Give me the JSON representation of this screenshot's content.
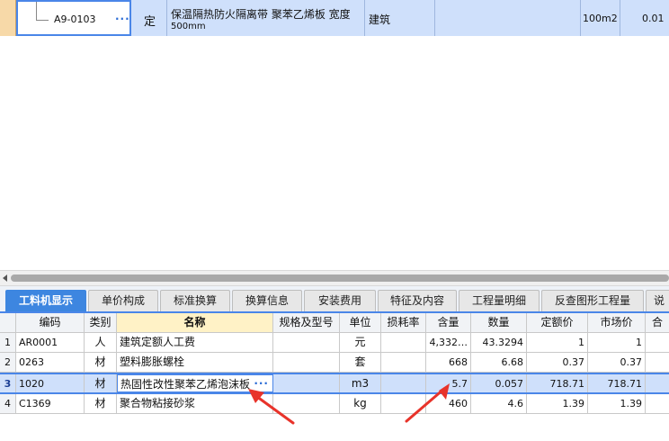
{
  "quota_row": {
    "code": "A9-0103",
    "type": "定",
    "name_line1": "保温隔热防火隔离带 聚苯乙烯板 宽度",
    "name_line2": "500mm",
    "profession": "建筑",
    "unit": "100m2",
    "quantity": "0.01"
  },
  "ellipsis": "···",
  "tabs": [
    {
      "label": "工料机显示",
      "active": true
    },
    {
      "label": "单价构成"
    },
    {
      "label": "标准换算"
    },
    {
      "label": "换算信息"
    },
    {
      "label": "安装费用"
    },
    {
      "label": "特征及内容"
    },
    {
      "label": "工程量明细"
    },
    {
      "label": "反查图形工程量"
    },
    {
      "label": "说"
    }
  ],
  "grid": {
    "headers": [
      "编码",
      "类别",
      "名称",
      "规格及型号",
      "单位",
      "损耗率",
      "含量",
      "数量",
      "定额价",
      "市场价",
      "合"
    ],
    "rows": [
      {
        "num": "1",
        "code": "AR0001",
        "type": "人",
        "name": "建筑定额人工费",
        "spec": "",
        "unit": "元",
        "loss": "",
        "content": "4,332…",
        "qty": "43.3294",
        "quota_price": "1",
        "market_price": "1"
      },
      {
        "num": "2",
        "code": "0263",
        "type": "材",
        "name": "塑料膨胀螺栓",
        "spec": "",
        "unit": "套",
        "loss": "",
        "content": "668",
        "qty": "6.68",
        "quota_price": "0.37",
        "market_price": "0.37"
      },
      {
        "num": "3",
        "code": "1020",
        "type": "材",
        "name": "热固性改性聚苯乙烯泡沫板",
        "spec": "",
        "unit": "m3",
        "loss": "",
        "content": "5.7",
        "qty": "0.057",
        "quota_price": "718.71",
        "market_price": "718.71"
      },
      {
        "num": "4",
        "code": "C1369",
        "type": "材",
        "name": "聚合物粘接砂浆",
        "spec": "",
        "unit": "kg",
        "loss": "",
        "content": "460",
        "qty": "4.6",
        "quota_price": "1.39",
        "market_price": "1.39"
      }
    ]
  },
  "colors": {
    "accent": "#4a86e8",
    "selection": "#cfe0fb",
    "active_tab": "#3d86e0",
    "annotation_arrow": "#e8332a",
    "name_header": "#fff2c6"
  }
}
